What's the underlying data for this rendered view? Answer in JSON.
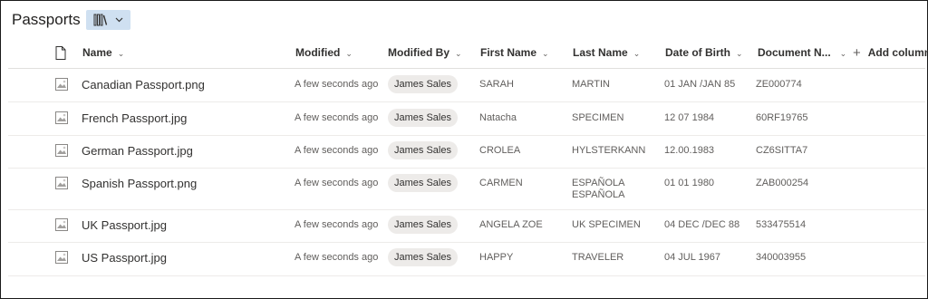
{
  "library": {
    "title": "Passports"
  },
  "columns": {
    "name": "Name",
    "modified": "Modified",
    "modified_by": "Modified By",
    "first_name": "First Name",
    "last_name": "Last Name",
    "dob": "Date of Birth",
    "doc_no": "Document N...",
    "add_column": "Add column"
  },
  "rows": [
    {
      "name": "Canadian Passport.png",
      "modified": "A few seconds ago",
      "modified_by": "James Sales",
      "first_name": "SARAH",
      "last_name": "MARTIN",
      "last_name2": "",
      "dob": "01 JAN /JAN 85",
      "doc_no": "ZE000774"
    },
    {
      "name": "French Passport.jpg",
      "modified": "A few seconds ago",
      "modified_by": "James Sales",
      "first_name": "Natacha",
      "last_name": "SPECIMEN",
      "last_name2": "",
      "dob": "12 07 1984",
      "doc_no": "60RF19765"
    },
    {
      "name": "German Passport.jpg",
      "modified": "A few seconds ago",
      "modified_by": "James Sales",
      "first_name": "CROLEA",
      "last_name": "HYLSTERKANN",
      "last_name2": "",
      "dob": "12.00.1983",
      "doc_no": "CZ6SITTA7"
    },
    {
      "name": "Spanish Passport.png",
      "modified": "A few seconds ago",
      "modified_by": "James Sales",
      "first_name": "CARMEN",
      "last_name": "ESPAÑOLA",
      "last_name2": "ESPAÑOLA",
      "dob": "01 01 1980",
      "doc_no": "ZAB000254"
    },
    {
      "name": "UK Passport.jpg",
      "modified": "A few seconds ago",
      "modified_by": "James Sales",
      "first_name": "ANGELA ZOE",
      "last_name": "UK SPECIMEN",
      "last_name2": "",
      "dob": "04 DEC /DEC 88",
      "doc_no": "533475514"
    },
    {
      "name": "US Passport.jpg",
      "modified": "A few seconds ago",
      "modified_by": "James Sales",
      "first_name": "HAPPY",
      "last_name": "TRAVELER",
      "last_name2": "",
      "dob": "04 JUL 1967",
      "doc_no": "340003955"
    }
  ],
  "icons": {
    "view": "library-books-icon",
    "file_header": "document-icon",
    "row_file": "image-file-icon",
    "add": "plus-icon",
    "sort": "chevron-down-icon"
  },
  "colors": {
    "accent_bg": "#cfe0f1",
    "pill_bg": "#edebe9"
  }
}
